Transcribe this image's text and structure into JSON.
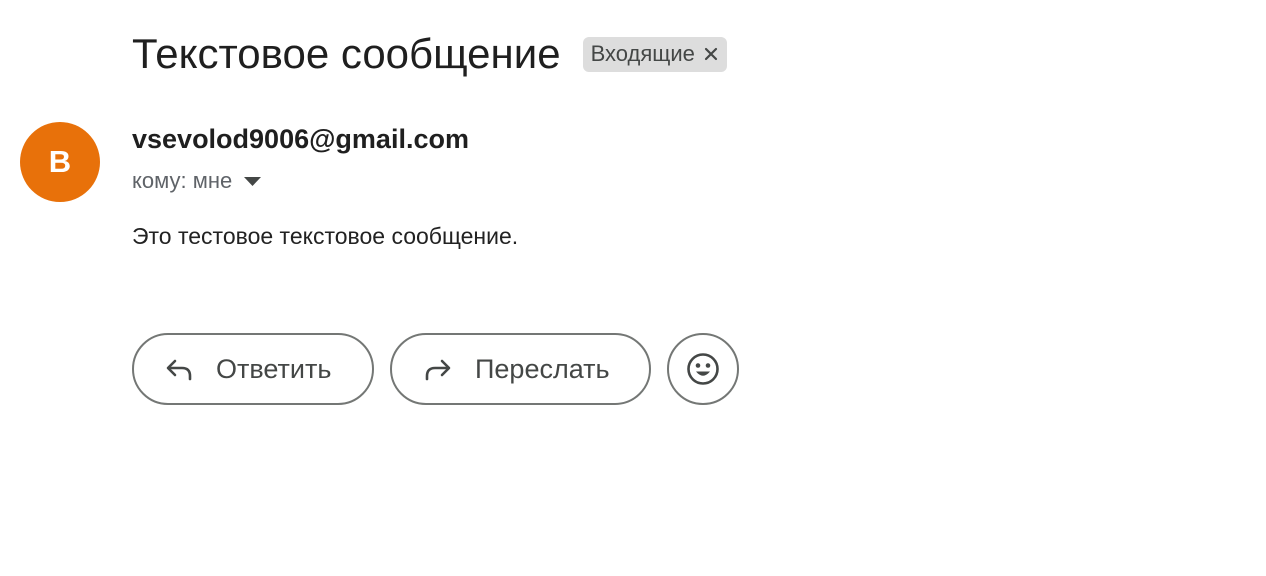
{
  "message": {
    "subject": "Текстовое сообщение",
    "label": {
      "text": "Входящие",
      "close_icon": "close-icon"
    },
    "sender": {
      "avatar_letter": "В",
      "avatar_color": "#e8710a",
      "email": "vsevolod9006@gmail.com"
    },
    "recipients_text": "кому: мне",
    "body": "Это тестовое текстовое сообщение."
  },
  "actions": {
    "reply": {
      "label": "Ответить",
      "icon": "reply-icon"
    },
    "forward": {
      "label": "Переслать",
      "icon": "forward-icon"
    },
    "emoji": {
      "icon": "emoji-icon"
    }
  }
}
